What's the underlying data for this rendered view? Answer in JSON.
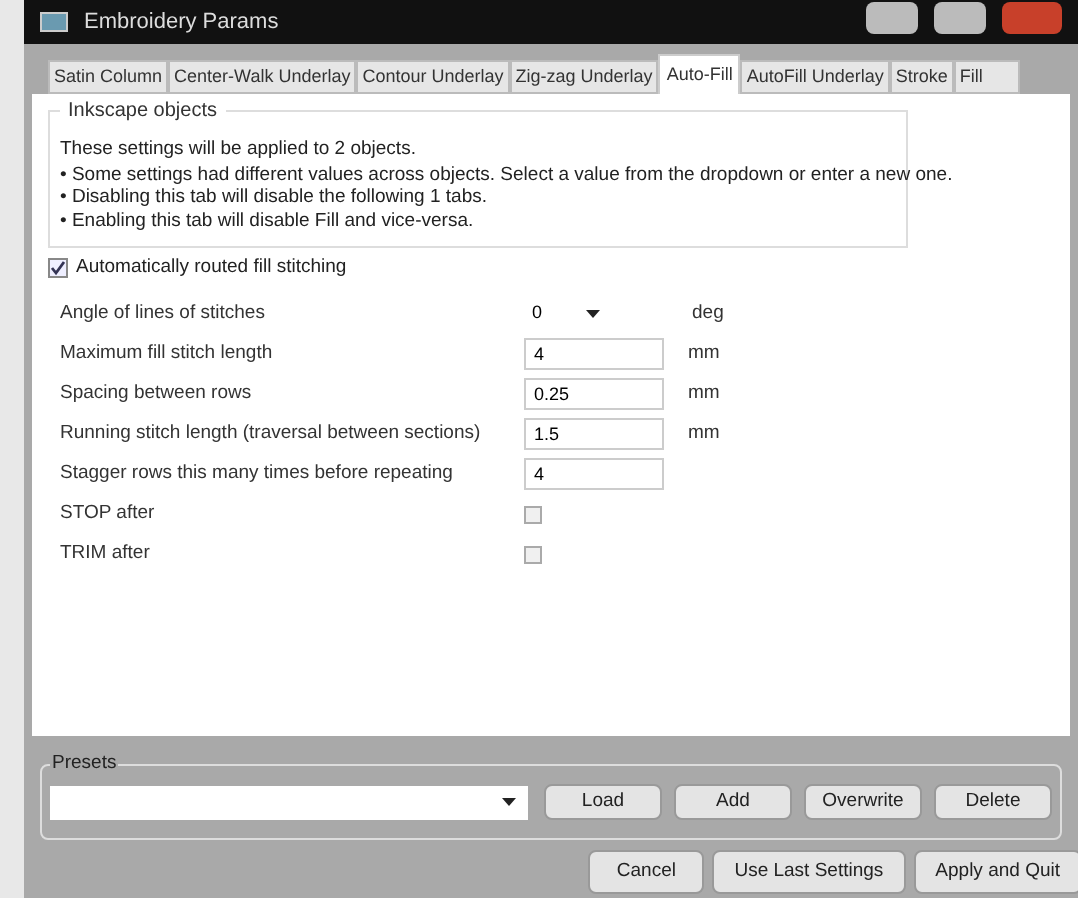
{
  "window": {
    "title": "Embroidery Params"
  },
  "tabs": [
    {
      "label": "Satin Column",
      "selected": false
    },
    {
      "label": "Center-Walk Underlay",
      "selected": false
    },
    {
      "label": "Contour Underlay",
      "selected": false
    },
    {
      "label": "Zig-zag Underlay",
      "selected": false
    },
    {
      "label": "Auto-Fill",
      "selected": true
    },
    {
      "label": "AutoFill Underlay",
      "selected": false
    },
    {
      "label": "Stroke",
      "selected": false
    },
    {
      "label": "Fill",
      "selected": false
    }
  ],
  "info": {
    "title": "Inkscape objects",
    "lines": [
      "These settings will be applied to 2 objects.",
      "• Some settings had different values across objects.  Select a value from the dropdown or enter a new one.",
      "• Disabling this tab will disable the following 1 tabs.",
      "• Enabling this tab will disable Fill and vice-versa."
    ]
  },
  "enable": {
    "label": "Automatically routed fill stitching",
    "checked": true
  },
  "params": [
    {
      "kind": "dropdown",
      "label": "Angle of lines of stitches",
      "value": "0",
      "unit": "deg"
    },
    {
      "kind": "text",
      "label": "Maximum fill stitch length",
      "value": "4",
      "unit": "mm"
    },
    {
      "kind": "text",
      "label": "Spacing between rows",
      "value": "0.25",
      "unit": "mm"
    },
    {
      "kind": "text",
      "label": "Running stitch length (traversal between sections)",
      "value": "1.5",
      "unit": "mm"
    },
    {
      "kind": "text",
      "label": "Stagger rows this many times before repeating",
      "value": "4"
    },
    {
      "kind": "checkbox",
      "label": "STOP after",
      "checked": false
    },
    {
      "kind": "checkbox",
      "label": "TRIM after",
      "checked": false
    }
  ],
  "presets": {
    "title": "Presets",
    "buttons": [
      "Load",
      "Add",
      "Overwrite",
      "Delete"
    ]
  },
  "buttons": [
    "Cancel",
    "Use Last Settings",
    "Apply and Quit"
  ]
}
